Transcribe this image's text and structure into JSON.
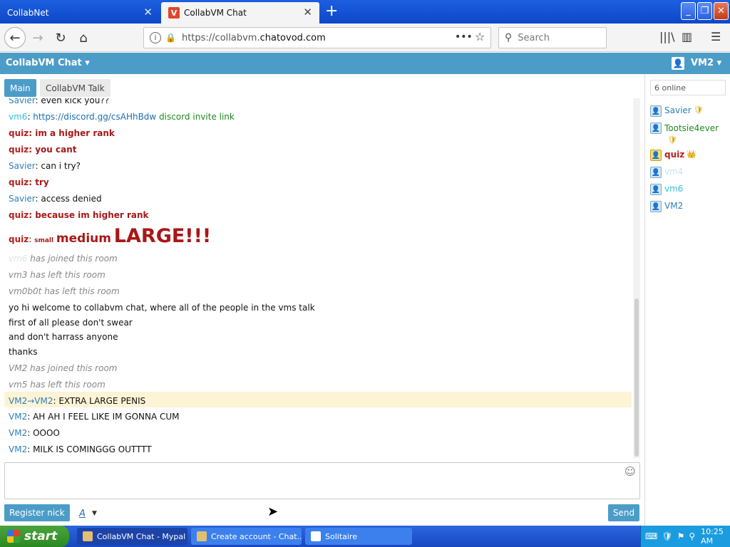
{
  "browser": {
    "tabs": [
      {
        "label": "CollabNet"
      },
      {
        "label": "CollabVM Chat"
      }
    ],
    "url_prefix": "https://collabvm.",
    "url_domain": "chatovod.com",
    "search_placeholder": "Search"
  },
  "app": {
    "title": "CollabVM Chat ▾",
    "user": "VM2 ▾"
  },
  "chat_tabs": [
    "Main",
    "CollabVM Talk"
  ],
  "messages": [
    {
      "nick": "Savier",
      "sep": ": ",
      "text": "even kick you??"
    },
    {
      "nick": "vm6",
      "sep": ": ",
      "link": "https://discord.gg/csAHhBdw",
      "text": " discord invite link"
    },
    {
      "nick": "quiz",
      "sep": ": ",
      "text": "im a higher rank"
    },
    {
      "nick": "quiz",
      "sep": ": ",
      "text": "you cant"
    },
    {
      "nick": "Savier",
      "sep": ": ",
      "text": "can i try?"
    },
    {
      "nick": "quiz",
      "sep": ": ",
      "text": "try"
    },
    {
      "nick": "Savier",
      "sep": ": ",
      "text": "access denied"
    },
    {
      "nick": "quiz",
      "sep": ": ",
      "text": "because im higher rank"
    },
    {
      "nick": "quiz",
      "sep": ": ",
      "small": "small",
      "medium": "medium",
      "large": "LARGE!!!"
    },
    {
      "nick": "vm6",
      "text": " has joined this room"
    },
    {
      "nick": "vm3",
      "text": " has left this room"
    },
    {
      "nick": "vm0b0t",
      "text": " has left this room"
    },
    {
      "text": "yo hi welcome to collabvm chat, where all of the people in the vms talk"
    },
    {
      "text": "first of all please don't swear"
    },
    {
      "text": "and don't harrass anyone"
    },
    {
      "text": "thanks"
    },
    {
      "nick": "VM2",
      "text": " has joined this room"
    },
    {
      "nick": "vm5",
      "text": " has left this room"
    },
    {
      "nick": "VM2",
      "arrow": "→",
      "to": "VM2",
      "sep": ": ",
      "text": "EXTRA LARGE PENIS"
    },
    {
      "nick": "VM2",
      "sep": ": ",
      "text": "AH AH I FEEL LIKE IM GONNA CUM"
    },
    {
      "nick": "VM2",
      "sep": ": ",
      "text": "OOOO"
    },
    {
      "nick": "VM2",
      "sep": ": ",
      "text": "MILK IS COMINGGG OUTTTT"
    }
  ],
  "composer": {
    "register": "Register nick",
    "font": "A",
    "send": "Send"
  },
  "users": {
    "online": "6 online",
    "list": [
      {
        "name": "Savier",
        "badge": "🛡"
      },
      {
        "name": "Tootsie4ever",
        "badge": "🛡"
      },
      {
        "name": "quiz",
        "badge": "👑"
      },
      {
        "name": "vm4"
      },
      {
        "name": "vm6"
      },
      {
        "name": "VM2"
      }
    ]
  },
  "taskbar": {
    "start": "start",
    "tasks": [
      "CollabVM Chat - Mypal",
      "Create account - Chat...",
      "Solitaire"
    ],
    "clock": "10:25 AM"
  }
}
